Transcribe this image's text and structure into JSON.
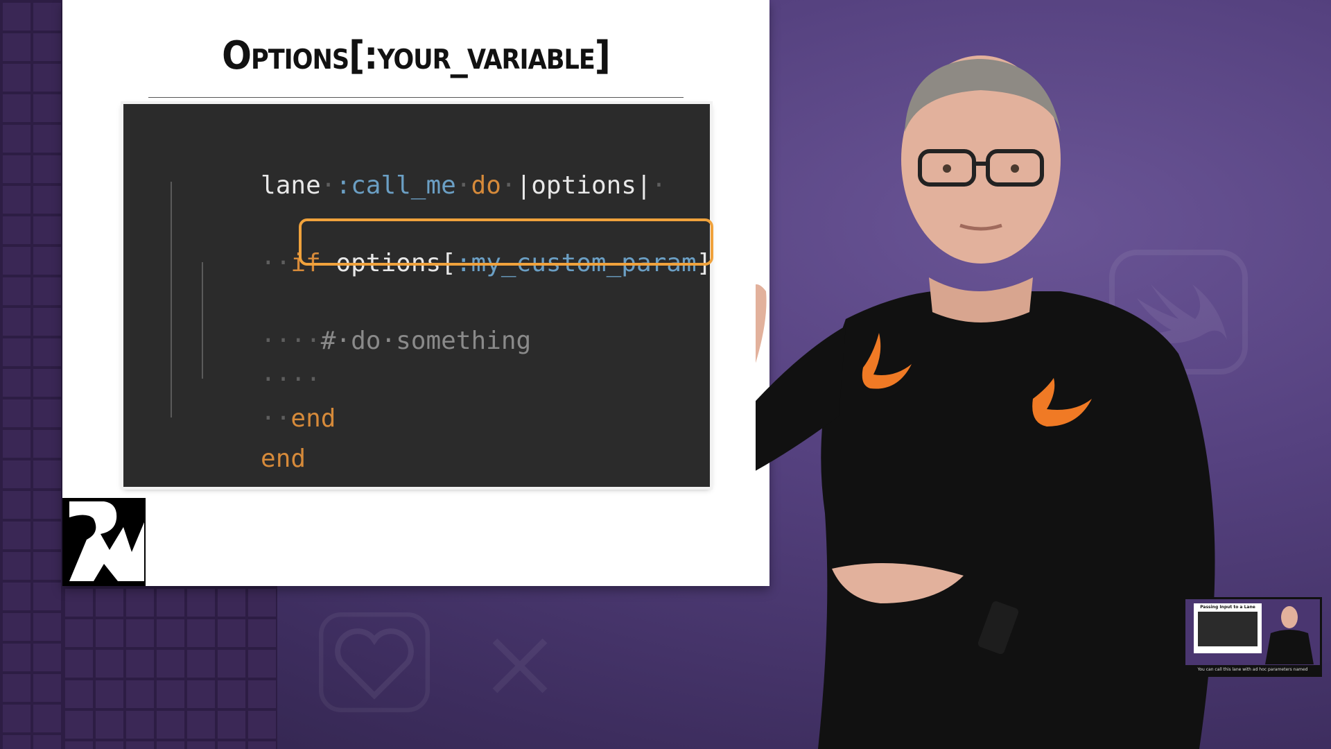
{
  "slide": {
    "title": "Options[:your_variable]",
    "code": {
      "line1": {
        "kw1": "lane",
        "dot1": "·",
        "sym": ":call_me",
        "dot2": "·",
        "kw2": "do",
        "dot3": "·",
        "pipe_open": "|",
        "param": "options",
        "pipe_close": "|",
        "dot4": "·"
      },
      "line2": {
        "indent": "··",
        "kw": "if",
        "space": " ",
        "expr_var": "options",
        "bracket_open": "[",
        "expr_sym": ":my_custom_param",
        "bracket_close": "]"
      },
      "line3": {
        "indent": "····",
        "comment": "#·do·something"
      },
      "line4": {
        "indent": "····"
      },
      "line5": {
        "indent": "··",
        "kw": "end"
      },
      "line6": {
        "kw": "end"
      }
    }
  },
  "pip": {
    "title": "Passing Input to a Lane",
    "caption": "You can call this lane with ad hoc parameters named"
  },
  "colors": {
    "keyword": "#d68a3a",
    "symbol": "#6b9fc4",
    "highlight": "#f0a23c",
    "background": "#4d3a73"
  }
}
